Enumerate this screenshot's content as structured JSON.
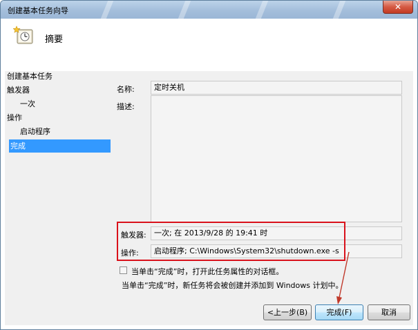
{
  "window": {
    "title": "创建基本任务向导",
    "close_glyph": "✕"
  },
  "header": {
    "title": "摘要",
    "icon": "task-clock-icon"
  },
  "nav": {
    "items": [
      {
        "label": "创建基本任务"
      },
      {
        "label": "触发器"
      },
      {
        "label": "一次"
      },
      {
        "label": "操作"
      },
      {
        "label": "启动程序"
      },
      {
        "label": "完成",
        "selected": true
      }
    ]
  },
  "form": {
    "name_label": "名称:",
    "name_value": "定时关机",
    "desc_label": "描述:",
    "desc_value": "",
    "trigger_label": "触发器:",
    "trigger_value": "一次; 在 2013/9/28 的 19:41 时",
    "action_label": "操作:",
    "action_value": "启动程序; C:\\Windows\\System32\\shutdown.exe -s"
  },
  "checkbox": {
    "label": "当单击“完成”时，打开此任务属性的对话框。",
    "checked": false
  },
  "info_text": "当单击“完成”时，新任务将会被创建并添加到 Windows 计划中。",
  "buttons": {
    "back": "<上一步(B)",
    "finish": "完成(F)",
    "cancel": "取消"
  },
  "colors": {
    "selection": "#3399ff",
    "highlight_box": "#d9101a",
    "annotation_arrow": "#c0392b"
  }
}
